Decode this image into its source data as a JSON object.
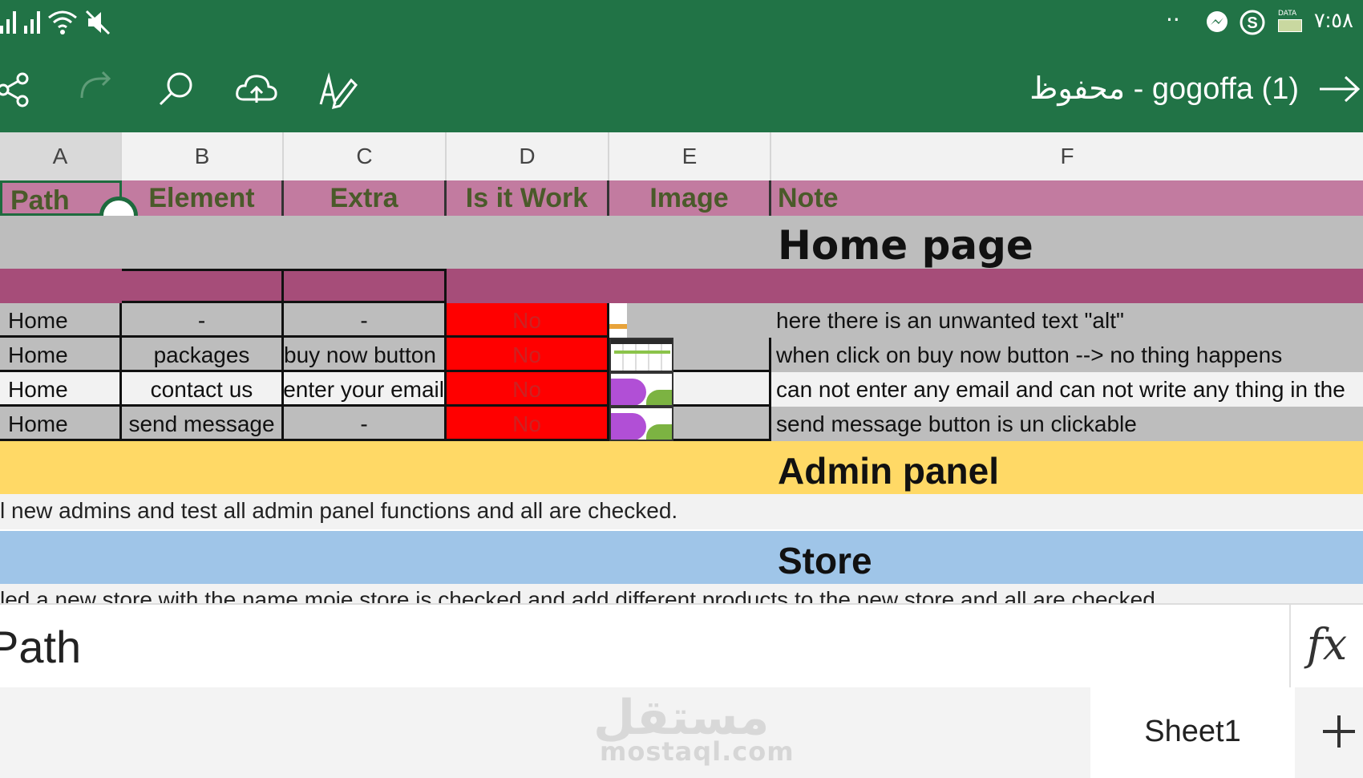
{
  "status_bar": {
    "time": "٧:٥٨",
    "data_label": "DATA",
    "icons": [
      "signal-icon",
      "signal-icon",
      "wifi-icon",
      "mute-icon",
      "dots-icon",
      "messenger-icon",
      "skype-icon",
      "battery-icon"
    ]
  },
  "toolbar": {
    "title": "محفوظ - gogoffa (1)",
    "icons": [
      "share-icon",
      "redo-icon",
      "search-icon",
      "cloud-upload-icon",
      "pen-icon",
      "arrow-right-icon"
    ]
  },
  "columns": [
    "A",
    "B",
    "C",
    "D",
    "E",
    "F"
  ],
  "header_row": {
    "path": "Path",
    "element": "Element",
    "extra": "Extra",
    "is_it_work": "Is it Work",
    "image": "Image",
    "note": "Note"
  },
  "sections": {
    "home": "Home page",
    "admin": "Admin panel",
    "admin_note": "l new admins and test all admin panel functions and all are checked.",
    "store": "Store",
    "store_note": "led a new store with the name moje store is checked and add different products to the new store and all are checked"
  },
  "rows": [
    {
      "path": "Home",
      "element": "-",
      "extra": "-",
      "work": "No",
      "note": "here there is an unwanted text \"alt\""
    },
    {
      "path": "Home",
      "element": "packages",
      "extra": "buy now button",
      "work": "No",
      "note": "when click on buy now button --> no thing happens"
    },
    {
      "path": "Home",
      "element": "contact us",
      "extra": "enter your email",
      "work": "No",
      "note": "can not enter any email and can not write any thing in the"
    },
    {
      "path": "Home",
      "element": "send message",
      "extra": "-",
      "work": "No",
      "note": "send message button is un clickable"
    }
  ],
  "formula_bar": {
    "value": "Path",
    "fx_label": "fx"
  },
  "sheet_tab": "Sheet1",
  "watermark": {
    "arabic": "مستقل",
    "latin": "mostaql.com"
  },
  "colors": {
    "excel_green": "#217346",
    "header_pink": "#c27ba0",
    "purple_row": "#a64d79",
    "no_red": "#ff0000",
    "admin_yellow": "#ffd966",
    "store_blue": "#9fc5e8"
  }
}
